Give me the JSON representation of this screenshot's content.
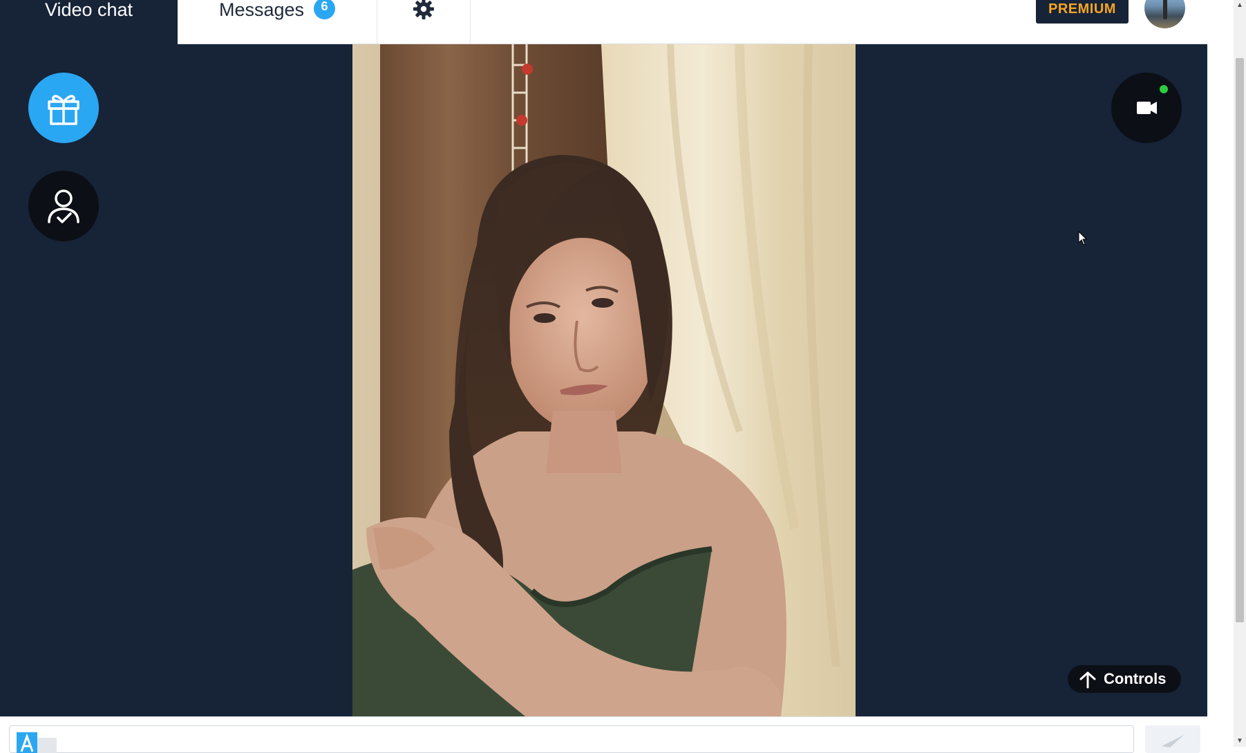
{
  "header": {
    "tabs": [
      {
        "label": "Video chat",
        "active": true
      },
      {
        "label": "Messages",
        "badge": "6"
      },
      {
        "icon": "gear-icon"
      }
    ],
    "premium_label": "PREMIUM",
    "avatar_icon": "user-avatar"
  },
  "stage": {
    "left_actions": [
      {
        "icon": "gift-icon"
      },
      {
        "icon": "user-check-icon"
      }
    ],
    "right_actions": [
      {
        "icon": "video-camera-icon",
        "status": "active"
      }
    ],
    "controls_label": "Controls",
    "controls_icon": "arrow-up-icon"
  },
  "composer": {
    "input_value": "",
    "translate_icon": "translate-icon",
    "send_icon": "send-icon"
  },
  "colors": {
    "navy": "#172337",
    "accent_blue": "#2aa7f2",
    "premium_orange": "#f5a623",
    "status_green": "#2ecc40",
    "dark_button": "#0c0f16"
  }
}
